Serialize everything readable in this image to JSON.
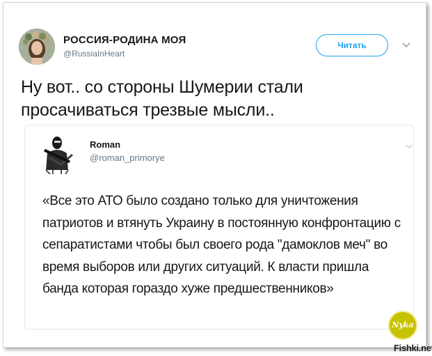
{
  "tweet": {
    "author_name": "РОССИЯ-РОДИНА МОЯ",
    "author_handle": "@RussiaInHeart",
    "follow_label": "Читать",
    "text": "Ну вот.. со стороны Шумерии стали просачиваться трезвые мысли.."
  },
  "quote": {
    "author_name": "Roman",
    "author_handle": "@roman_primorye",
    "text": "«Все это АТО было создано только для уничтожения патриотов и втянуть Украину в постоянную конфронтацию с сепаратистами чтобы был своего рода \"дамоклов меч\" во время выборов или других ситуаций. К власти пришла банда которая гораздо хуже предшественников»"
  },
  "watermark": {
    "badge": "Nyka",
    "site": "Fishki.net"
  },
  "colors": {
    "accent": "#1da1f2",
    "secondary_text": "#657786",
    "border": "#e1e8ed"
  }
}
